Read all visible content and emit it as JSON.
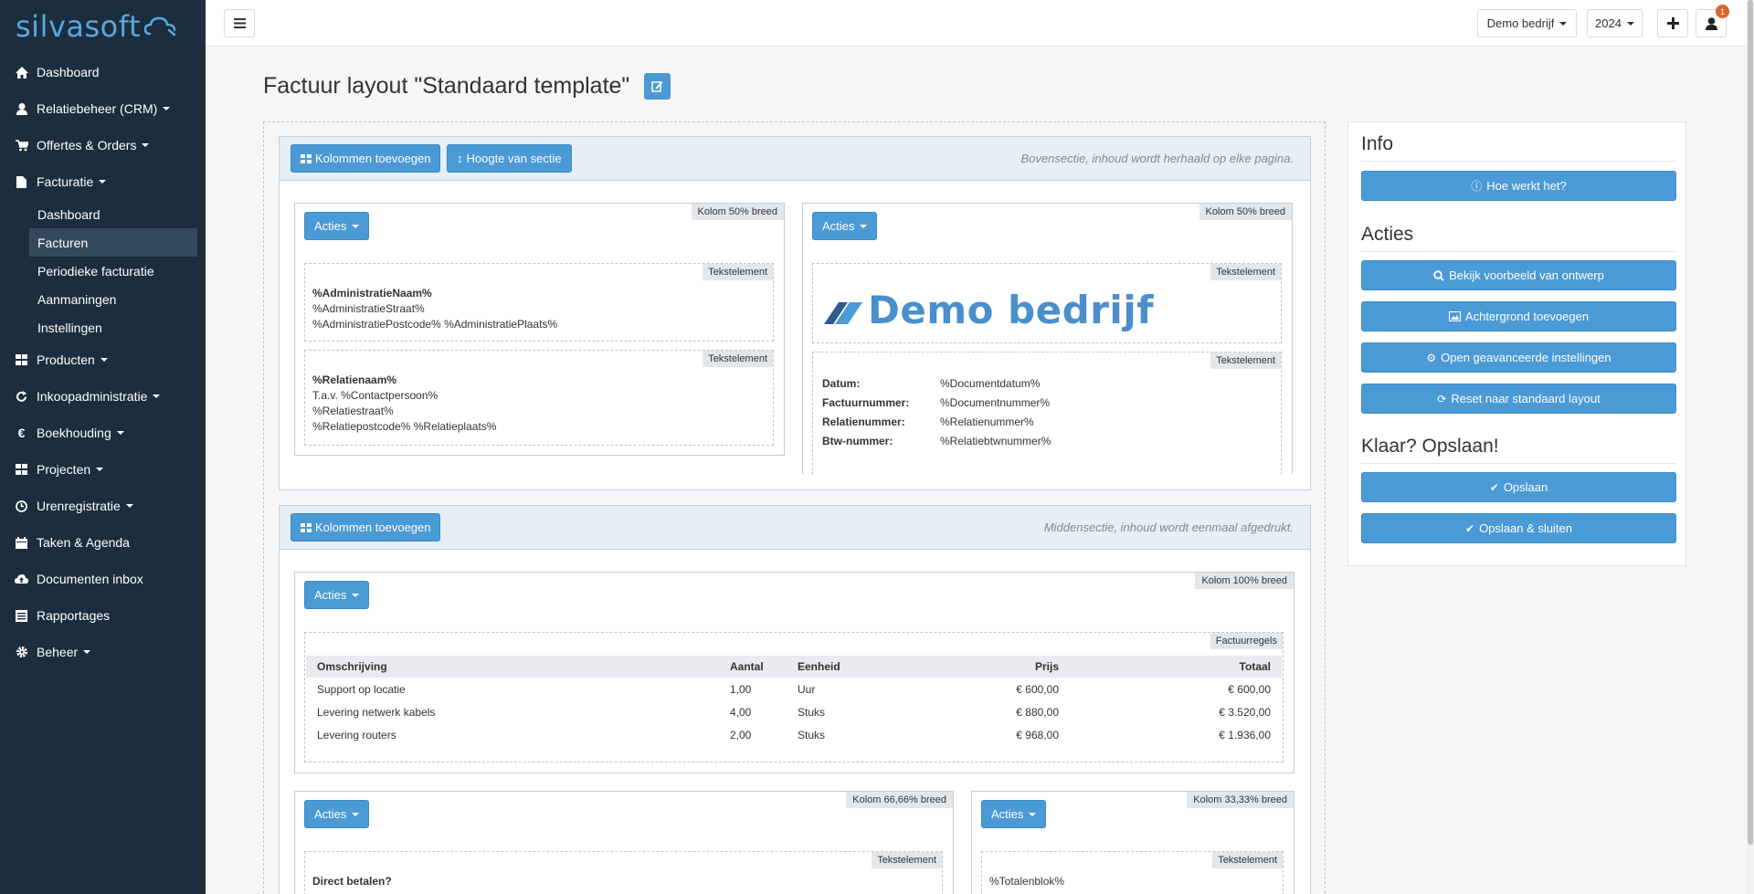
{
  "app": {
    "logo_text": "silvasoft"
  },
  "sidebar": {
    "items": [
      {
        "label": "Dashboard",
        "icon": "home-icon"
      },
      {
        "label": "Relatiebeheer (CRM)",
        "icon": "user-icon"
      },
      {
        "label": "Offertes & Orders",
        "icon": "cart-icon"
      },
      {
        "label": "Facturatie",
        "icon": "file-icon"
      },
      {
        "label": "Producten",
        "icon": "grid-icon"
      },
      {
        "label": "Inkoopadministratie",
        "icon": "refresh-icon"
      },
      {
        "label": "Boekhouding",
        "icon": "euro-icon"
      },
      {
        "label": "Projecten",
        "icon": "grid-icon"
      },
      {
        "label": "Urenregistratie",
        "icon": "clock-icon"
      },
      {
        "label": "Taken & Agenda",
        "icon": "calendar-icon"
      },
      {
        "label": "Documenten inbox",
        "icon": "cloud-upload-icon"
      },
      {
        "label": "Rapportages",
        "icon": "report-icon"
      },
      {
        "label": "Beheer",
        "icon": "gear-icon"
      }
    ],
    "facturatie_sub": [
      "Dashboard",
      "Facturen",
      "Periodieke facturatie",
      "Aanmaningen",
      "Instellingen"
    ],
    "active_sub": "Facturen"
  },
  "topbar": {
    "company": "Demo bedrijf",
    "year": "2024",
    "notification_count": "1"
  },
  "page": {
    "title": "Factuur layout \"Standaard template\""
  },
  "top_section": {
    "add_columns": "Kolommen toevoegen",
    "height": "Hoogte van sectie",
    "note": "Bovensectie, inhoud wordt herhaald op elke pagina.",
    "col_left_tag": "Kolom 50% breed",
    "col_right_tag": "Kolom 50% breed",
    "actions": "Acties",
    "element_tag": "Tekstelement",
    "admin_block": [
      "%AdministratieNaam%",
      "%AdministratieStraat%",
      "%AdministratiePostcode% %AdministratiePlaats%"
    ],
    "relation_block": [
      "%Relatienaam%",
      "T.a.v. %Contactpersoon%",
      "%Relatiestraat%",
      "%Relatiepostcode% %Relatieplaats%"
    ],
    "company_logo_text": "Demo bedrijf",
    "doc_fields": [
      {
        "label": "Datum:",
        "value": "%Documentdatum%"
      },
      {
        "label": "Factuurnummer:",
        "value": "%Documentnummer%"
      },
      {
        "label": "Relatienummer:",
        "value": "%Relatienummer%"
      },
      {
        "label": "Btw-nummer:",
        "value": "%Relatiebtwnummer%"
      }
    ]
  },
  "middle_section": {
    "add_columns": "Kolommen toevoegen",
    "note": "Middensectie, inhoud wordt eenmaal afgedrukt.",
    "col_full_tag": "Kolom 100% breed",
    "lines_tag": "Factuurregels",
    "table_headers": [
      "Omschrijving",
      "Aantal",
      "Eenheid",
      "Prijs",
      "Totaal"
    ],
    "rows": [
      [
        "Support op locatie",
        "1,00",
        "Uur",
        "€ 600,00",
        "€ 600,00"
      ],
      [
        "Levering netwerk kabels",
        "4,00",
        "Stuks",
        "€ 880,00",
        "€ 3.520,00"
      ],
      [
        "Levering routers",
        "2,00",
        "Stuks",
        "€ 968,00",
        "€ 1.936,00"
      ]
    ],
    "col_wide_tag": "Kolom 66,66% breed",
    "col_narrow_tag": "Kolom 33,33% breed",
    "direct_pay": "Direct betalen?",
    "totals_block": "%Totalenblok%"
  },
  "panel": {
    "info_title": "Info",
    "how_it_works": "Hoe werkt het?",
    "actions_title": "Acties",
    "preview": "Bekijk voorbeeld van ontwerp",
    "background": "Achtergrond toevoegen",
    "advanced": "Open geavanceerde instellingen",
    "reset": "Reset naar standaard layout",
    "save_title": "Klaar? Opslaan!",
    "save": "Opslaan",
    "save_close": "Opslaan & sluiten"
  },
  "colors": {
    "sidebar_bg": "#1c2d3e",
    "accent": "#4a9ad6",
    "logo": "#5aa6dc"
  }
}
